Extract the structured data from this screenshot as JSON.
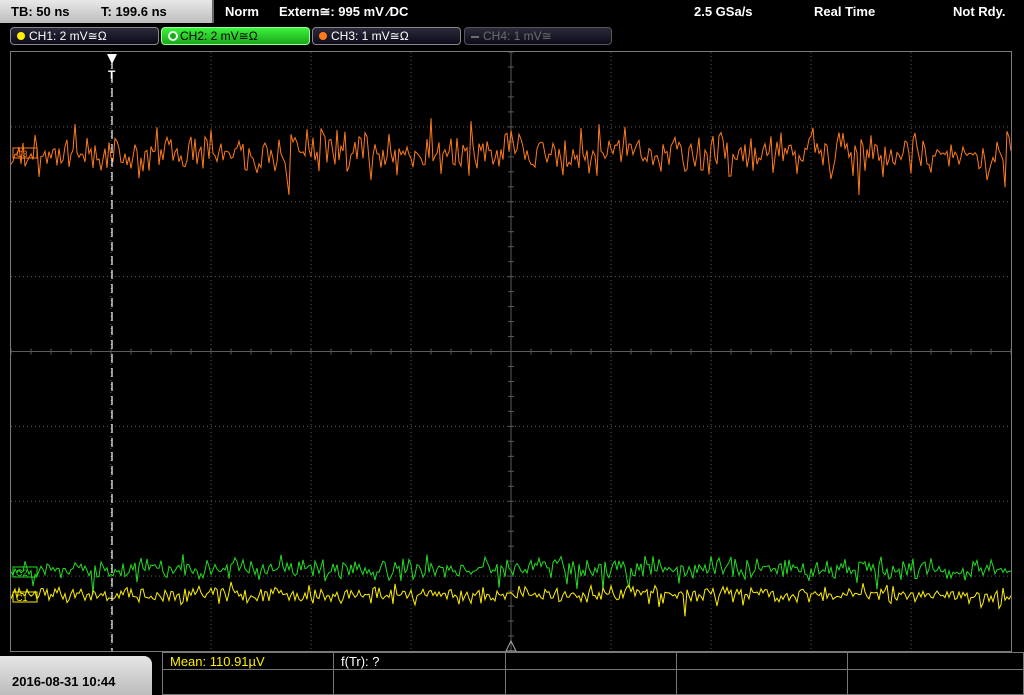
{
  "timebase": {
    "tb": "TB: 50 ns",
    "trigger_time": "T: 199.6 ns"
  },
  "status": {
    "mode": "Norm",
    "trigger": "Extern≅: 995 mV ∕DC",
    "sample_rate": "2.5 GSa/s",
    "acq": "Real Time",
    "ready": "Not Rdy."
  },
  "channels": [
    {
      "label": "CH1: 2 mV≅Ω",
      "color": "#ffef00",
      "state": "on"
    },
    {
      "label": "CH2: 2 mV≅Ω",
      "color": "#22dd22",
      "state": "selected"
    },
    {
      "label": "CH3: 1 mV≅Ω",
      "color": "#ff7a1a",
      "state": "on"
    },
    {
      "label": "CH4: 1 mV≅",
      "color": "#6d6d6d",
      "state": "off"
    }
  ],
  "markers": {
    "trigger": "T",
    "ch3": "C3",
    "ch2": "C2",
    "ch1": "C1"
  },
  "measurements": {
    "mean": "Mean: 110.91µV",
    "ftr": "f(Tr): ?"
  },
  "datetime": "2016-08-31 10:44",
  "colors": {
    "grid": "#5a5a5a",
    "ch1": "#ffef00",
    "ch2": "#22dd22",
    "ch3": "#ff7a1a"
  }
}
